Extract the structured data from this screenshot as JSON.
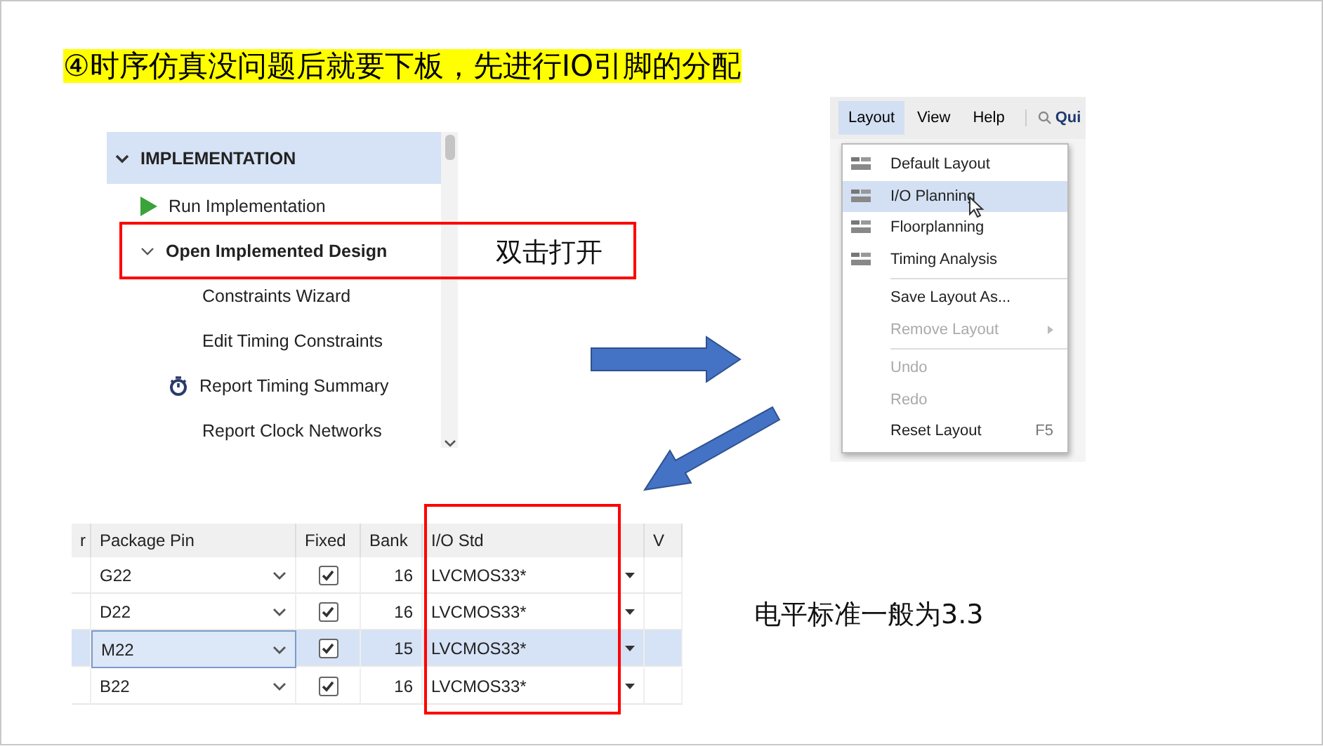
{
  "title": "④时序仿真没问题后就要下板，先进行IO引脚的分配",
  "flow_navigator": {
    "section": {
      "label": "IMPLEMENTATION",
      "expanded": true
    },
    "items": [
      {
        "kind": "run",
        "label": "Run Implementation"
      },
      {
        "kind": "group",
        "label": "Open Implemented Design",
        "expanded": true
      },
      {
        "kind": "sub",
        "label": "Constraints Wizard"
      },
      {
        "kind": "sub",
        "label": "Edit Timing Constraints"
      },
      {
        "kind": "timer",
        "label": "Report Timing Summary"
      },
      {
        "kind": "sub",
        "label": "Report Clock Networks"
      }
    ]
  },
  "callout_open": "双击打开",
  "menu": {
    "menubar": [
      {
        "label": "Layout",
        "selected": true
      },
      {
        "label": "View",
        "selected": false
      },
      {
        "label": "Help",
        "selected": false
      }
    ],
    "search": {
      "placeholder": "Qui"
    },
    "items": [
      {
        "kind": "layout",
        "label": "Default Layout",
        "highlighted": false,
        "disabled": false
      },
      {
        "kind": "layout",
        "label": "I/O Planning",
        "highlighted": true,
        "disabled": false
      },
      {
        "kind": "layout",
        "label": "Floorplanning",
        "highlighted": false,
        "disabled": false
      },
      {
        "kind": "layout",
        "label": "Timing Analysis",
        "highlighted": false,
        "disabled": false
      },
      {
        "kind": "separator"
      },
      {
        "kind": "plain",
        "label": "Save Layout As...",
        "highlighted": false,
        "disabled": false
      },
      {
        "kind": "submenu",
        "label": "Remove Layout",
        "highlighted": false,
        "disabled": true
      },
      {
        "kind": "separator"
      },
      {
        "kind": "plain",
        "label": "Undo",
        "highlighted": false,
        "disabled": true
      },
      {
        "kind": "plain",
        "label": "Redo",
        "highlighted": false,
        "disabled": true
      },
      {
        "kind": "plain",
        "label": "Reset Layout",
        "shortcut": "F5",
        "highlighted": false,
        "disabled": false
      }
    ]
  },
  "table": {
    "columns": [
      "r",
      "Package Pin",
      "Fixed",
      "Bank",
      "I/O Std",
      "V"
    ],
    "rows": [
      {
        "package_pin": "G22",
        "fixed": true,
        "bank": "16",
        "io_std": "LVCMOS33*",
        "selected": false
      },
      {
        "package_pin": "D22",
        "fixed": true,
        "bank": "16",
        "io_std": "LVCMOS33*",
        "selected": false
      },
      {
        "package_pin": "M22",
        "fixed": true,
        "bank": "15",
        "io_std": "LVCMOS33*",
        "selected": true
      },
      {
        "package_pin": "B22",
        "fixed": true,
        "bank": "16",
        "io_std": "LVCMOS33*",
        "selected": false
      }
    ]
  },
  "note": "电平标准一般为3.3"
}
